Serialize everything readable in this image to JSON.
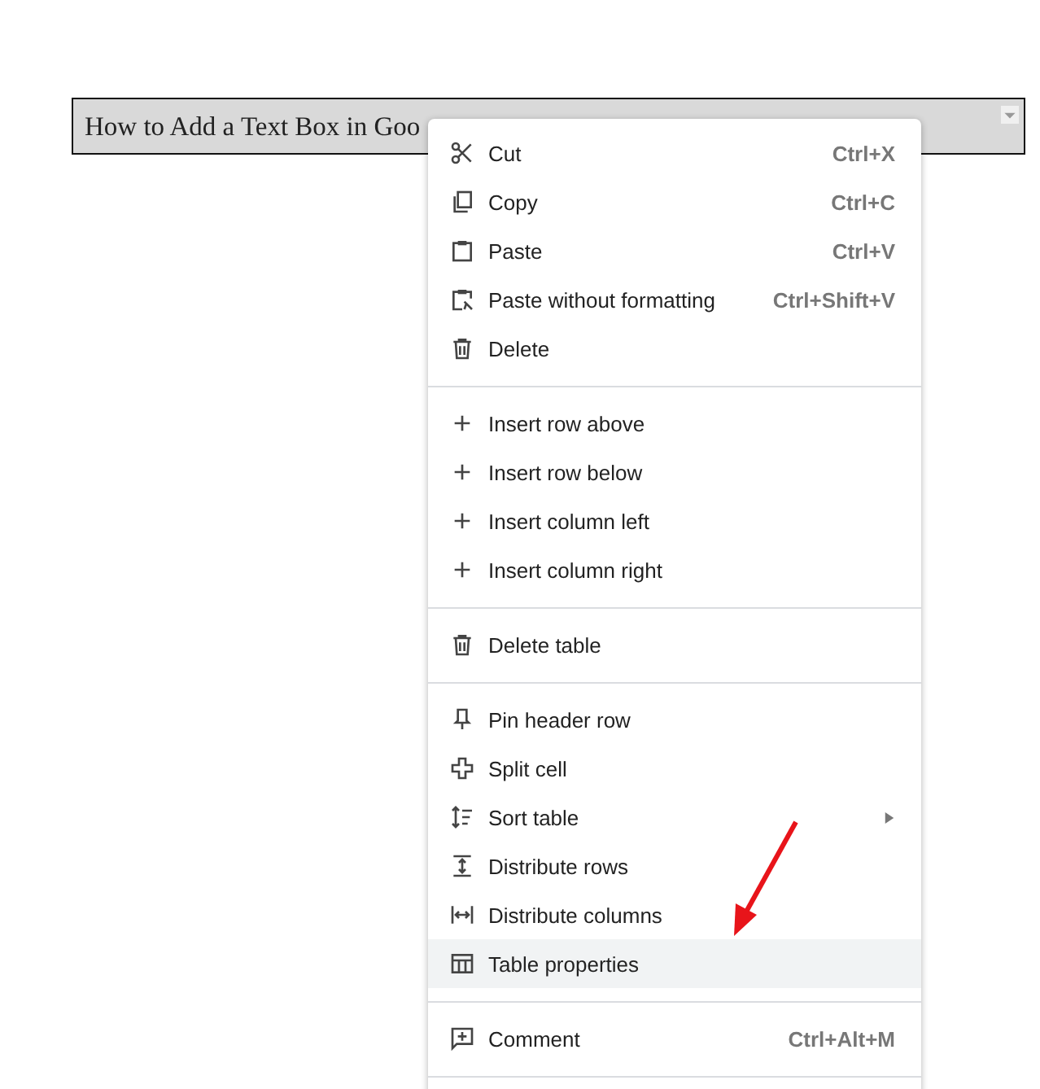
{
  "table_cell": {
    "text": "How to Add a Text Box in Goo"
  },
  "context_menu": {
    "groups": [
      [
        {
          "kind": "cut",
          "label": "Cut",
          "shortcut": "Ctrl+X",
          "selected": false,
          "submenu": false
        },
        {
          "kind": "copy",
          "label": "Copy",
          "shortcut": "Ctrl+C",
          "selected": false,
          "submenu": false
        },
        {
          "kind": "paste",
          "label": "Paste",
          "shortcut": "Ctrl+V",
          "selected": false,
          "submenu": false
        },
        {
          "kind": "paste-plain",
          "label": "Paste without formatting",
          "shortcut": "Ctrl+Shift+V",
          "selected": false,
          "submenu": false
        },
        {
          "kind": "trash",
          "label": "Delete",
          "selected": false,
          "submenu": false
        }
      ],
      [
        {
          "kind": "plus",
          "label": "Insert row above",
          "selected": false,
          "submenu": false
        },
        {
          "kind": "plus",
          "label": "Insert row below",
          "selected": false,
          "submenu": false
        },
        {
          "kind": "plus",
          "label": "Insert column left",
          "selected": false,
          "submenu": false
        },
        {
          "kind": "plus",
          "label": "Insert column right",
          "selected": false,
          "submenu": false
        }
      ],
      [
        {
          "kind": "trash",
          "label": "Delete table",
          "selected": false,
          "submenu": false
        }
      ],
      [
        {
          "kind": "pin",
          "label": "Pin header row",
          "selected": false,
          "submenu": false
        },
        {
          "kind": "split",
          "label": "Split cell",
          "selected": false,
          "submenu": false
        },
        {
          "kind": "sort",
          "label": "Sort table",
          "selected": false,
          "submenu": true
        },
        {
          "kind": "dist-rows",
          "label": "Distribute rows",
          "selected": false,
          "submenu": false
        },
        {
          "kind": "dist-cols",
          "label": "Distribute columns",
          "selected": false,
          "submenu": false
        },
        {
          "kind": "table",
          "label": "Table properties",
          "selected": true,
          "submenu": false
        }
      ],
      [
        {
          "kind": "comment",
          "label": "Comment",
          "shortcut": "Ctrl+Alt+M",
          "selected": false,
          "submenu": false
        }
      ]
    ]
  },
  "overlay": {
    "kind": "arrow"
  }
}
